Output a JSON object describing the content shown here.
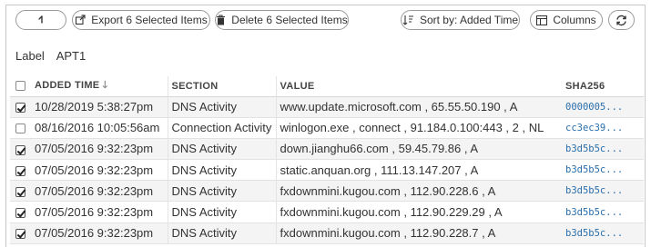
{
  "toolbar": {
    "back_icon": "back-arrow-icon",
    "export_label": "Export 6 Selected Items",
    "delete_label": "Delete 6 Selected Items",
    "sort_label": "Sort by: Added Time",
    "columns_label": "Columns"
  },
  "label": {
    "key": "Label",
    "value": "APT1"
  },
  "table": {
    "columns": {
      "added_time": "ADDED TIME",
      "section": "SECTION",
      "value": "VALUE",
      "sha256": "SHA256"
    },
    "rows": [
      {
        "checked": true,
        "added_time": "10/28/2019 5:38:27pm",
        "section": "DNS Activity",
        "value": "www.update.microsoft.com , 65.55.50.190 , A",
        "sha256": "0000005..."
      },
      {
        "checked": false,
        "added_time": "08/16/2016 10:05:56am",
        "section": "Connection Activity",
        "value": "winlogon.exe , connect , 91.184.0.100:443 , 2 , NL",
        "sha256": "cc3ec39..."
      },
      {
        "checked": true,
        "added_time": "07/05/2016 9:32:23pm",
        "section": "DNS Activity",
        "value": "down.jianghu66.com , 59.45.79.86 , A",
        "sha256": "b3d5b5c..."
      },
      {
        "checked": true,
        "added_time": "07/05/2016 9:32:23pm",
        "section": "DNS Activity",
        "value": "static.anquan.org , 111.13.147.207 , A",
        "sha256": "b3d5b5c..."
      },
      {
        "checked": true,
        "added_time": "07/05/2016 9:32:23pm",
        "section": "DNS Activity",
        "value": "fxdownmini.kugou.com , 112.90.228.6 , A",
        "sha256": "b3d5b5c..."
      },
      {
        "checked": true,
        "added_time": "07/05/2016 9:32:23pm",
        "section": "DNS Activity",
        "value": "fxdownmini.kugou.com , 112.90.229.29 , A",
        "sha256": "b3d5b5c..."
      },
      {
        "checked": true,
        "added_time": "07/05/2016 9:32:23pm",
        "section": "DNS Activity",
        "value": "fxdownmini.kugou.com , 112.90.228.7 , A",
        "sha256": "b3d5b5c..."
      }
    ]
  }
}
